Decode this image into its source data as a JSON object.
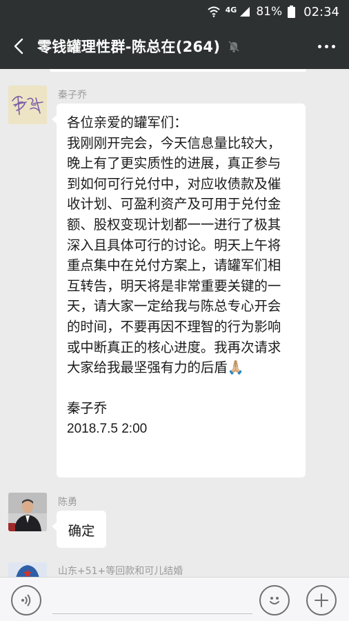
{
  "status_bar": {
    "network": "4G",
    "battery_percent": "81%",
    "time": "02:34"
  },
  "header": {
    "title": "零钱罐理性群-陈总在(264)"
  },
  "messages": [
    {
      "sender": "秦子乔",
      "text_lines": [
        "各位亲爱的罐军们：",
        "我刚刚开完会，今天信息量比较大，",
        "晚上有了更实质性的进展，真正参与",
        "到如何可行兑付中，对应收债款及催",
        "收计划、可盈利资产及可用于兑付金",
        "额、股权变现计划都一一进行了极其",
        "深入且具体可行的讨论。明天上午将",
        "重点集中在兑付方案上，请罐军们相",
        "互转告，明天将是非常重要关键的一",
        "天，请大家一定给我与陈总专心开会",
        "的时间，不要再因不理智的行为影响",
        "或中断真正的核心进度。我再次请求",
        "大家给我最坚强有力的后盾🙏🏼"
      ],
      "signature": "秦子乔",
      "signature_date": "2018.7.5 2:00"
    },
    {
      "sender": "陈勇",
      "text": "确定"
    },
    {
      "sender": "山东+51+等回款和可儿结婚"
    }
  ],
  "colors": {
    "header_bg": "#2e3132",
    "chat_bg": "#ebebeb",
    "bubble_bg": "#ffffff"
  }
}
